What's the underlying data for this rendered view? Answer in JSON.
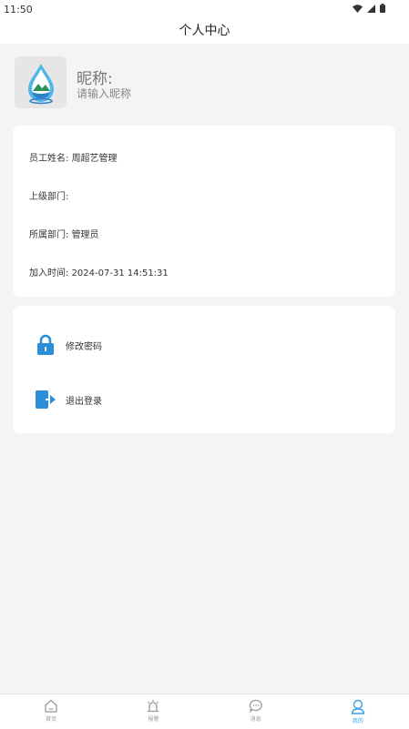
{
  "status_bar": {
    "time": "11:50"
  },
  "header": {
    "title": "个人中心"
  },
  "profile": {
    "nickname_label": "昵称:",
    "nickname_placeholder": "请输入昵称"
  },
  "info": {
    "employee_name_label": "员工姓名:",
    "employee_name_value": "周超艺管理",
    "parent_dept_label": "上级部门:",
    "parent_dept_value": "",
    "dept_label": "所属部门:",
    "dept_value": "管理员",
    "join_time_label": "加入时间:",
    "join_time_value": "2024-07-31 14:51:31"
  },
  "actions": {
    "change_password": "修改密码",
    "logout": "退出登录"
  },
  "tabs": [
    {
      "label": "首页",
      "icon": "home-icon"
    },
    {
      "label": "报警",
      "icon": "alarm-icon"
    },
    {
      "label": "消息",
      "icon": "message-icon"
    },
    {
      "label": "我的",
      "icon": "profile-icon",
      "active": true
    }
  ],
  "colors": {
    "accent": "#3aa0e6",
    "background": "#f4f4f4"
  }
}
